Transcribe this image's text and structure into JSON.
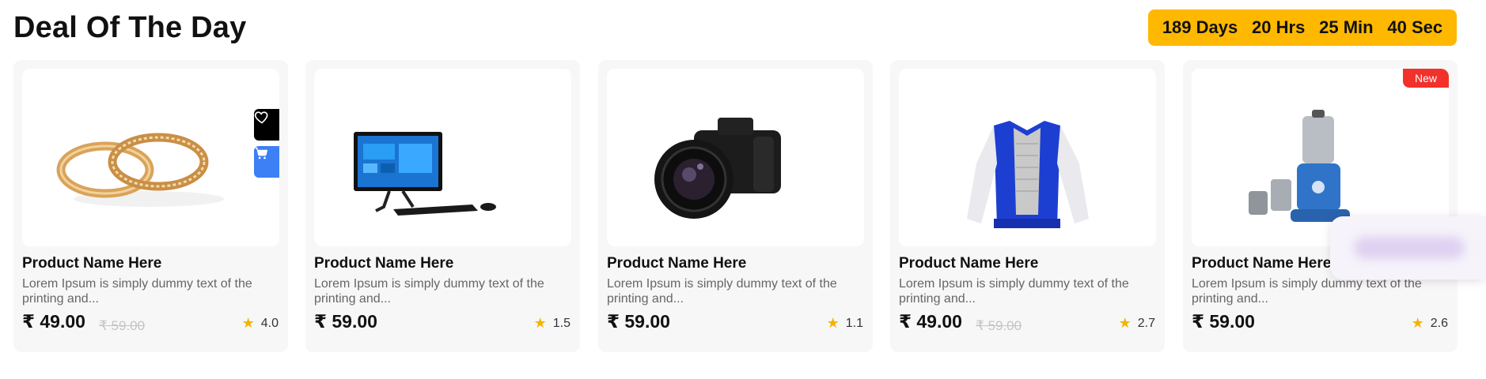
{
  "section": {
    "title": "Deal Of The Day"
  },
  "countdown": {
    "days": "189 Days",
    "hours": "20 Hrs",
    "minutes": "25 Min",
    "seconds": "40 Sec"
  },
  "colors": {
    "countdown_bg": "#ffb800",
    "cart_button": "#3d7ff5",
    "badge_new": "#f2312c",
    "star": "#f5b301"
  },
  "products": [
    {
      "name": "Product Name Here",
      "description": "Lorem Ipsum is simply dummy text of the printing and...",
      "price": "₹ 49.00",
      "old_price": "₹ 59.00",
      "rating": "4.0",
      "image": "gold-rings",
      "badge": ""
    },
    {
      "name": "Product Name Here",
      "description": "Lorem Ipsum is simply dummy text of the printing and...",
      "price": "₹ 59.00",
      "old_price": "",
      "rating": "1.5",
      "image": "all-in-one-desktop",
      "badge": ""
    },
    {
      "name": "Product Name Here",
      "description": "Lorem Ipsum is simply dummy text of the printing and...",
      "price": "₹ 59.00",
      "old_price": "",
      "rating": "1.1",
      "image": "mirrorless-camera",
      "badge": ""
    },
    {
      "name": "Product Name Here",
      "description": "Lorem Ipsum is simply dummy text of the printing and...",
      "price": "₹ 49.00",
      "old_price": "₹ 59.00",
      "rating": "2.7",
      "image": "varsity-jacket",
      "badge": ""
    },
    {
      "name": "Product Name Here",
      "description": "Lorem Ipsum is simply dummy text of the printing and...",
      "price": "₹ 59.00",
      "old_price": "",
      "rating": "2.6",
      "image": "mixer-grinder",
      "badge": "New"
    }
  ],
  "hover_actions": {
    "wishlist_icon": "heart-icon",
    "cart_icon": "cart-icon"
  }
}
